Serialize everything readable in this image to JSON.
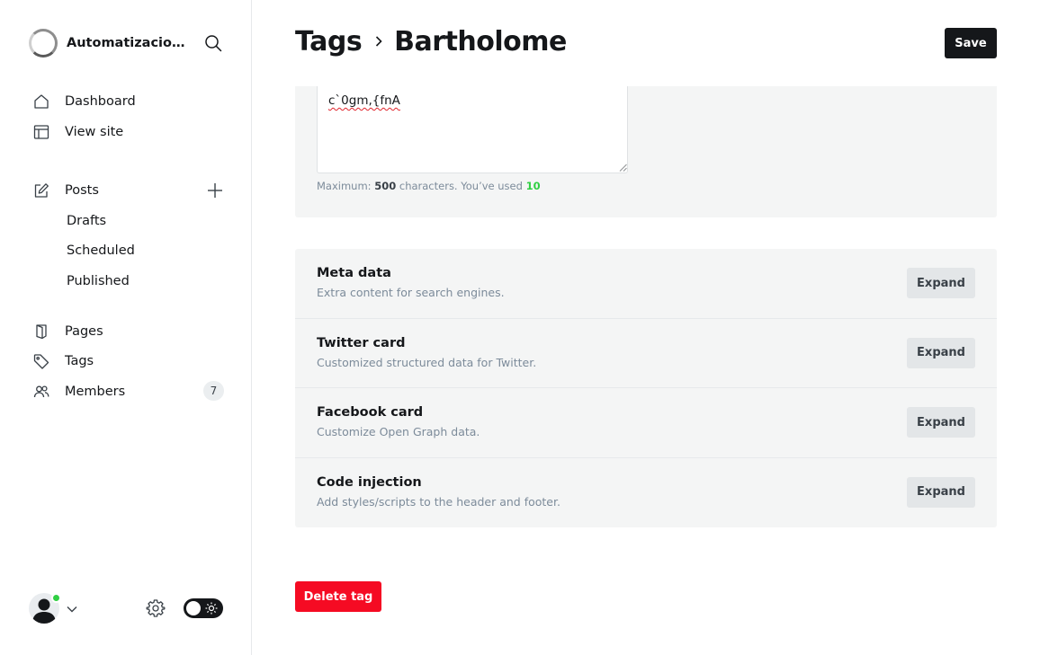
{
  "sidebar": {
    "site_name": "Automatizacion...",
    "nav": {
      "dashboard": "Dashboard",
      "view_site": "View site",
      "posts": "Posts",
      "drafts": "Drafts",
      "scheduled": "Scheduled",
      "published": "Published",
      "pages": "Pages",
      "tags": "Tags",
      "members": "Members",
      "members_count": "7"
    }
  },
  "header": {
    "parent": "Tags",
    "current": "Bartholome",
    "save_label": "Save"
  },
  "description": {
    "value": "c`0gm,{fnA",
    "hint_prefix": "Maximum:",
    "max": "500",
    "hint_middle": "characters. You’ve used",
    "used": "10"
  },
  "settings": [
    {
      "title": "Meta data",
      "desc": "Extra content for search engines.",
      "button": "Expand"
    },
    {
      "title": "Twitter card",
      "desc": "Customized structured data for Twitter.",
      "button": "Expand"
    },
    {
      "title": "Facebook card",
      "desc": "Customize Open Graph data.",
      "button": "Expand"
    },
    {
      "title": "Code injection",
      "desc": "Add styles/scripts to the header and footer.",
      "button": "Expand"
    }
  ],
  "delete_label": "Delete tag",
  "colors": {
    "accent_green": "#30cf43",
    "danger": "#f50b23",
    "dark": "#15171a"
  },
  "icons": {
    "search": "search-icon",
    "dashboard": "home-icon",
    "view_site": "layout-icon",
    "posts": "edit-icon",
    "add_post": "plus-icon",
    "pages": "page-icon",
    "tags": "tag-icon",
    "members": "members-icon",
    "settings": "gear-icon",
    "theme": "sun-icon"
  }
}
